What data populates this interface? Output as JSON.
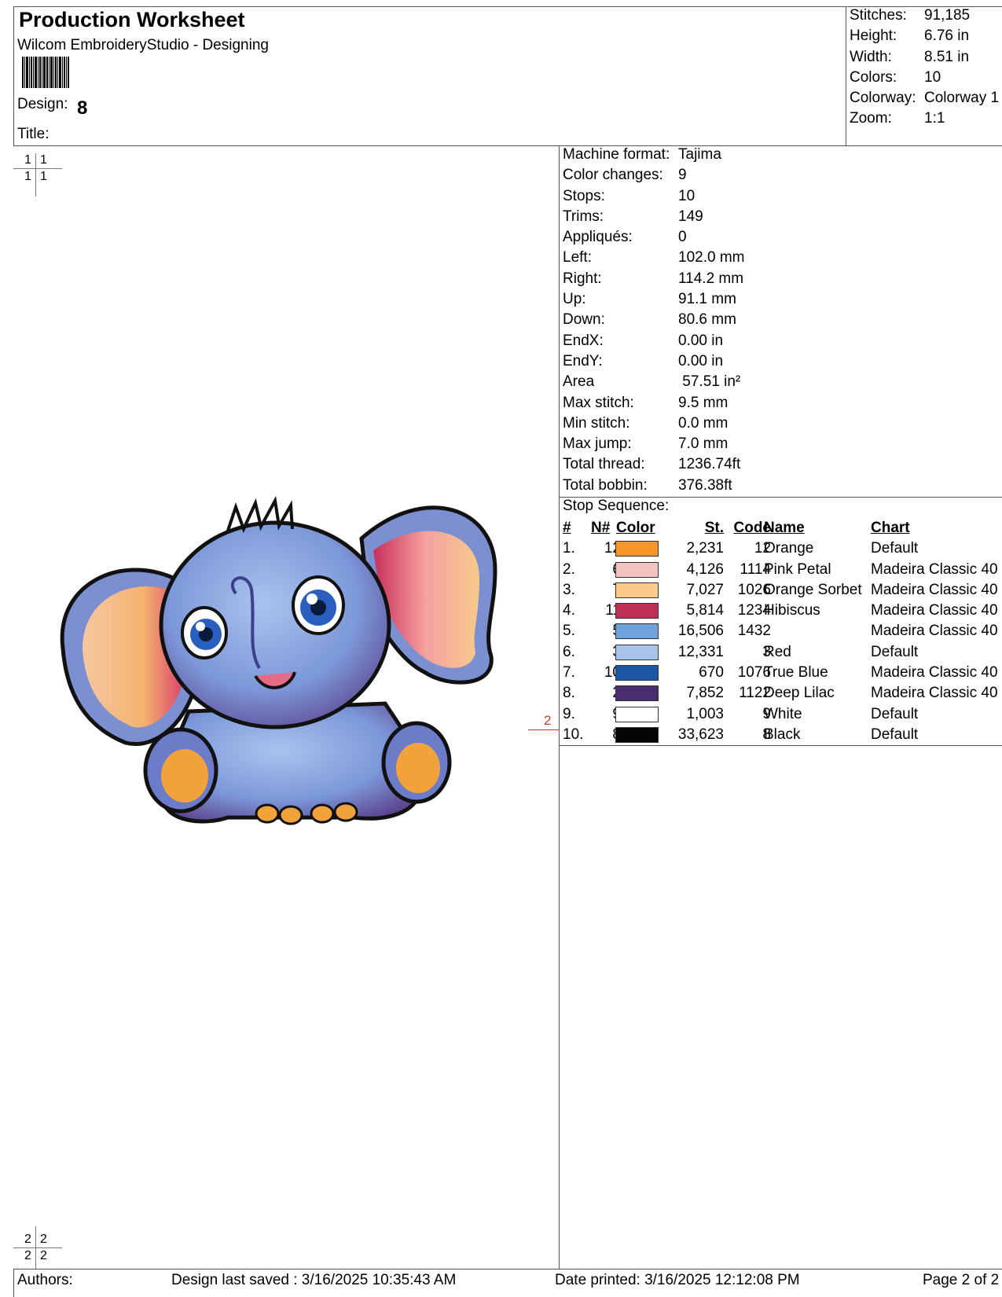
{
  "header": {
    "title": "Production Worksheet",
    "subtitle": "Wilcom EmbroideryStudio - Designing",
    "design_label": "Design:",
    "design_value": "8",
    "title_label": "Title:"
  },
  "summary": [
    {
      "k": "Stitches:",
      "v": "91,185"
    },
    {
      "k": "Height:",
      "v": "6.76 in"
    },
    {
      "k": "Width:",
      "v": "8.51 in"
    },
    {
      "k": "Colors:",
      "v": "10"
    },
    {
      "k": "Colorway:",
      "v": "Colorway 1"
    },
    {
      "k": "Zoom:",
      "v": "1:1"
    }
  ],
  "info": [
    {
      "k": "Machine format:",
      "v": "Tajima"
    },
    {
      "k": "Color changes:",
      "v": "9"
    },
    {
      "k": "Stops:",
      "v": "10"
    },
    {
      "k": "Trims:",
      "v": "149"
    },
    {
      "k": "Appliqués:",
      "v": "0"
    },
    {
      "k": "Left:",
      "v": "102.0 mm"
    },
    {
      "k": "Right:",
      "v": "114.2 mm"
    },
    {
      "k": "Up:",
      "v": "91.1 mm"
    },
    {
      "k": "Down:",
      "v": "80.6 mm"
    },
    {
      "k": "EndX:",
      "v": "0.00 in"
    },
    {
      "k": "EndY:",
      "v": "0.00 in"
    },
    {
      "k": "Area",
      "v": " 57.51 in²"
    },
    {
      "k": "Max stitch:",
      "v": "9.5 mm"
    },
    {
      "k": "Min stitch:",
      "v": "0.0 mm"
    },
    {
      "k": "Max jump:",
      "v": "7.0 mm"
    },
    {
      "k": "Total thread:",
      "v": "1236.74ft"
    },
    {
      "k": "Total bobbin:",
      "v": "376.38ft"
    }
  ],
  "stop_sequence": {
    "title": "Stop Sequence:",
    "headers": {
      "num": "#",
      "n": "N#",
      "color": "Color",
      "st": "St.",
      "code": "Code",
      "name": "Name",
      "chart": "Chart"
    },
    "rows": [
      {
        "num": "1.",
        "n": "12",
        "color": "#f7952d",
        "st": "2,231",
        "code": "12",
        "name": "Orange",
        "chart": "Default"
      },
      {
        "num": "2.",
        "n": "6",
        "color": "#f2c3c0",
        "st": "4,126",
        "code": "1114",
        "name": "Pink Petal",
        "chart": "Madeira Classic 40"
      },
      {
        "num": "3.",
        "n": "7",
        "color": "#fbc98a",
        "st": "7,027",
        "code": "1026",
        "name": "Orange Sorbet",
        "chart": "Madeira Classic 40"
      },
      {
        "num": "4.",
        "n": "11",
        "color": "#be2f55",
        "st": "5,814",
        "code": "1234",
        "name": "Hibiscus",
        "chart": "Madeira Classic 40"
      },
      {
        "num": "5.",
        "n": "5",
        "color": "#6fa2da",
        "st": "16,506",
        "code": "1432",
        "name": "",
        "chart": "Madeira Classic 40"
      },
      {
        "num": "6.",
        "n": "3",
        "color": "#a8c3ea",
        "st": "12,331",
        "code": "3",
        "name": "Red",
        "chart": "Default"
      },
      {
        "num": "7.",
        "n": "10",
        "color": "#1d57a8",
        "st": "670",
        "code": "1076",
        "name": "True Blue",
        "chart": "Madeira Classic 40"
      },
      {
        "num": "8.",
        "n": "2",
        "color": "#4a2d6e",
        "st": "7,852",
        "code": "1122",
        "name": "Deep Lilac",
        "chart": "Madeira Classic 40"
      },
      {
        "num": "9.",
        "n": "9",
        "color": "#ffffff",
        "st": "1,003",
        "code": "9",
        "name": "White",
        "chart": "Default"
      },
      {
        "num": "10.",
        "n": "8",
        "color": "#050505",
        "st": "33,623",
        "code": "8",
        "name": "Black",
        "chart": "Default"
      }
    ]
  },
  "marks": {
    "top": "1",
    "bottom": "2",
    "red_marker": "2"
  },
  "footer": {
    "authors": "Authors:",
    "saved": "Design last saved : 3/16/2025 10:35:43 AM",
    "printed": "Date printed: 3/16/2025 12:12:08 PM",
    "page": "Page 2 of 2"
  }
}
